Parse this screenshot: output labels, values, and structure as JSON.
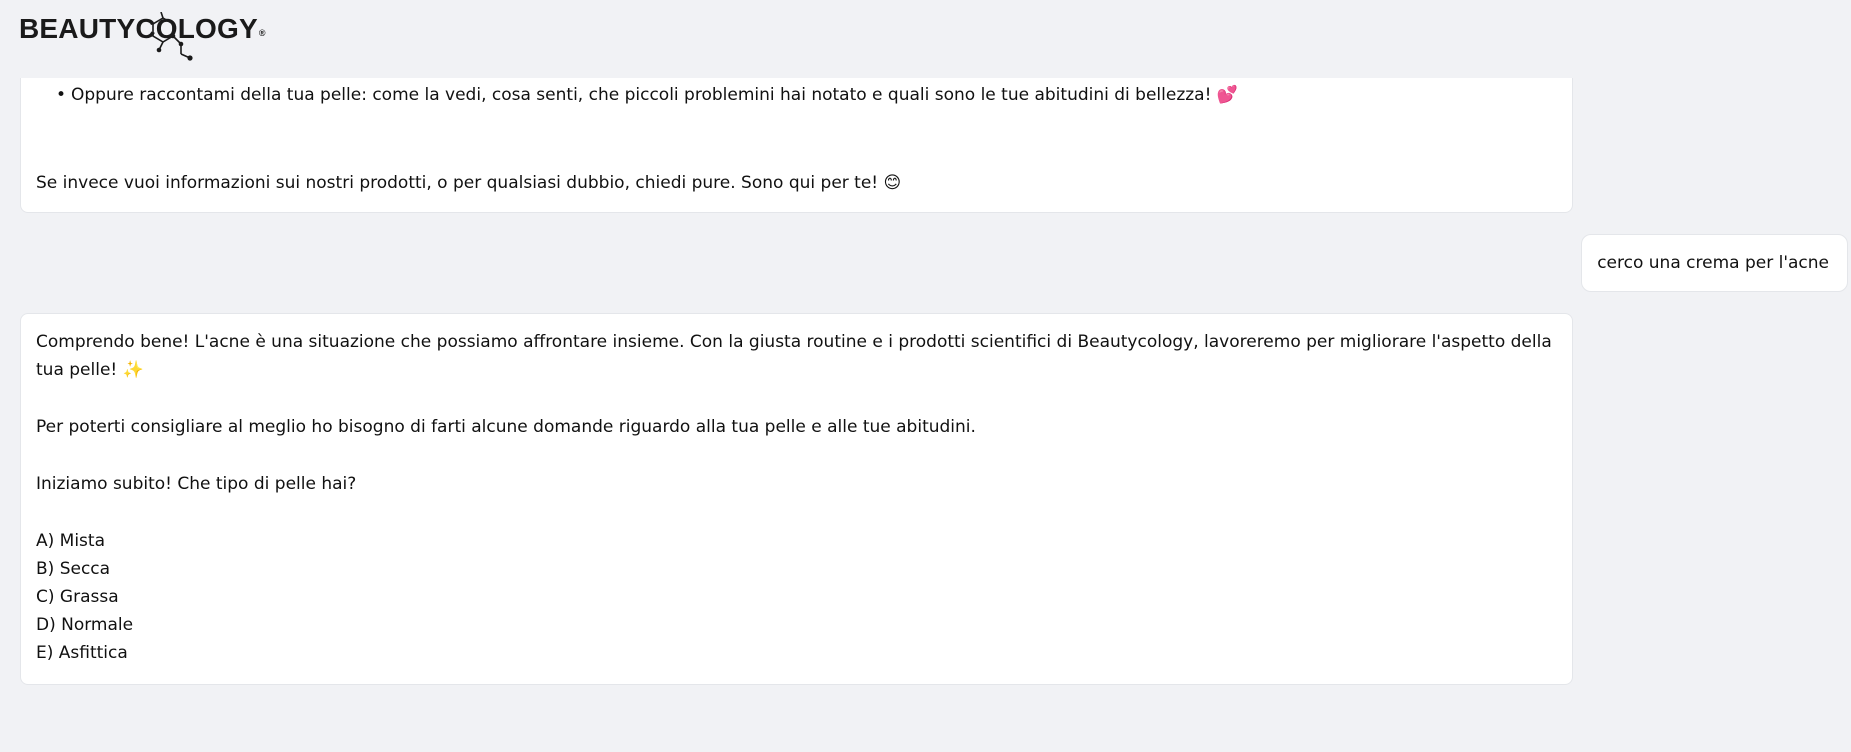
{
  "header": {
    "logo_text": "BEAUTYCOLOGY",
    "logo_reg": "®"
  },
  "messages": {
    "bot_1": {
      "bullet": "Oppure raccontami della tua pelle: come la vedi, cosa senti, che piccoli problemini hai notato e quali sono le tue abitudini di bellezza! 💕",
      "closing": "Se invece vuoi informazioni sui nostri prodotti, o per qualsiasi dubbio, chiedi pure. Sono qui per te! 😊"
    },
    "user_1": {
      "text": "cerco una crema per l'acne"
    },
    "bot_2": {
      "intro": "Comprendo bene! L'acne è una situazione che possiamo affrontare insieme. Con la giusta routine e i prodotti scientifici di Beautycology, lavoreremo per migliorare l'aspetto della tua pelle! ✨",
      "need": "Per poterti consigliare al meglio ho bisogno di farti alcune domande riguardo alla tua pelle e alle tue abitudini.",
      "question": "Iniziamo subito! Che tipo di pelle hai?",
      "options": [
        "A) Mista",
        "B) Secca",
        "C) Grassa",
        "D) Normale",
        "E) Asfittica"
      ]
    }
  }
}
